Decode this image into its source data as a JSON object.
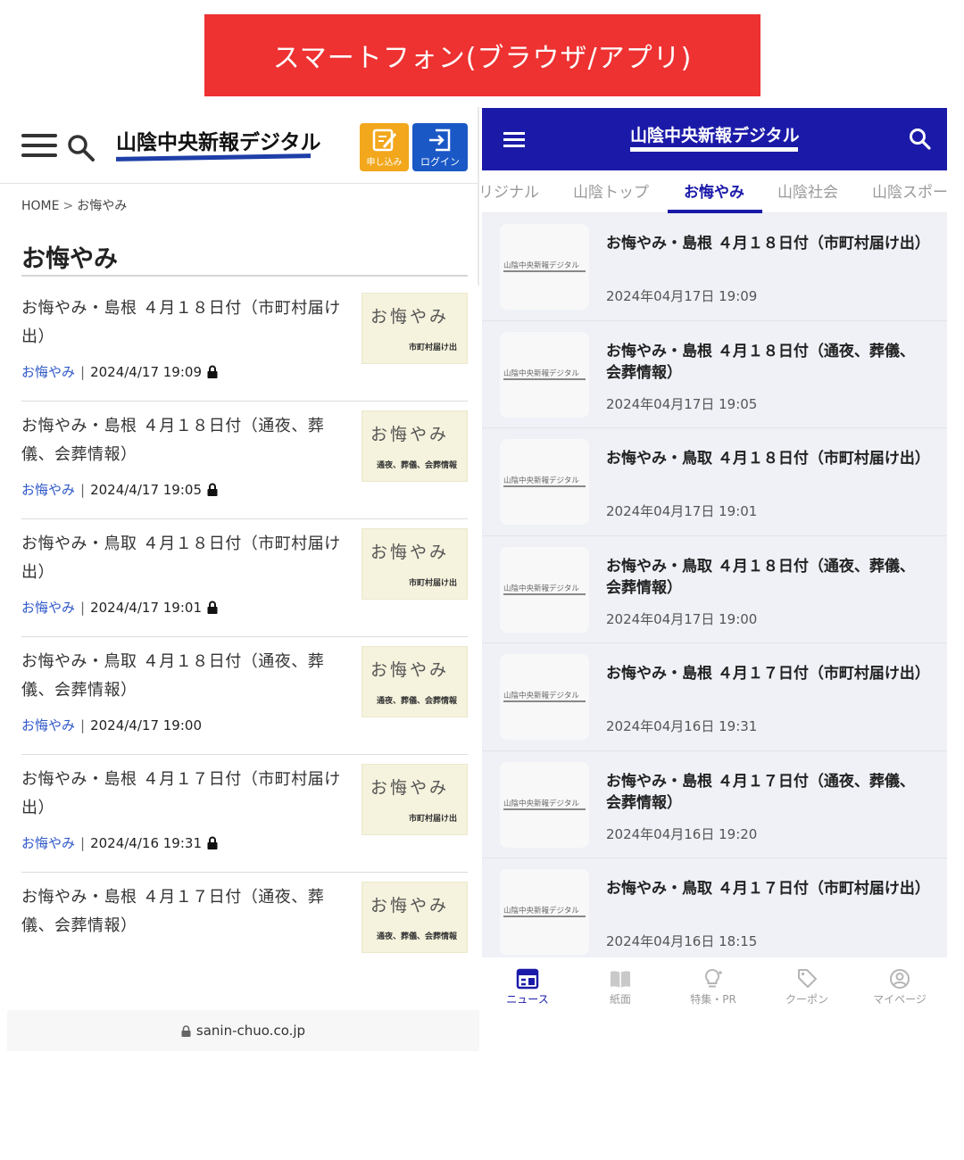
{
  "banner": {
    "text": "スマートフォン(ブラウザ/アプリ)"
  },
  "browser": {
    "logo": "山陰中央新報デジタル",
    "apply_label": "申し込み",
    "login_label": "ログイン",
    "breadcrumb": {
      "home": "HOME",
      "current": "お悔やみ"
    },
    "page_title": "お悔やみ",
    "articles": [
      {
        "title": "お悔やみ・島根 ４月１８日付（市町村届け出）",
        "category": "お悔やみ",
        "datetime": "2024/4/17 19:09",
        "locked": true,
        "thumb_main": "お悔やみ",
        "thumb_sub": "市町村届け出"
      },
      {
        "title": "お悔やみ・島根 ４月１８日付（通夜、葬儀、会葬情報）",
        "category": "お悔やみ",
        "datetime": "2024/4/17 19:05",
        "locked": true,
        "thumb_main": "お悔やみ",
        "thumb_sub": "通夜、葬儀、会葬情報"
      },
      {
        "title": "お悔やみ・鳥取 ４月１８日付（市町村届け出）",
        "category": "お悔やみ",
        "datetime": "2024/4/17 19:01",
        "locked": true,
        "thumb_main": "お悔やみ",
        "thumb_sub": "市町村届け出"
      },
      {
        "title": "お悔やみ・鳥取 ４月１８日付（通夜、葬儀、会葬情報）",
        "category": "お悔やみ",
        "datetime": "2024/4/17 19:00",
        "locked": false,
        "thumb_main": "お悔やみ",
        "thumb_sub": "通夜、葬儀、会葬情報"
      },
      {
        "title": "お悔やみ・島根 ４月１７日付（市町村届け出）",
        "category": "お悔やみ",
        "datetime": "2024/4/16 19:31",
        "locked": true,
        "thumb_main": "お悔やみ",
        "thumb_sub": "市町村届け出"
      },
      {
        "title": "お悔やみ・島根 ４月１７日付（通夜、葬儀、会葬情報）",
        "category": "",
        "datetime": "",
        "locked": false,
        "thumb_main": "お悔やみ",
        "thumb_sub": "通夜、葬儀、会葬情報"
      }
    ],
    "url": "sanin-chuo.co.jp"
  },
  "app": {
    "logo": "山陰中央新報デジタル",
    "tabs": [
      "リジナル",
      "山陰トップ",
      "お悔やみ",
      "山陰社会",
      "山陰スポー"
    ],
    "active_tab": "お悔やみ",
    "thumb_logo": "山陰中央新報デジタル",
    "articles": [
      {
        "title": "お悔やみ・島根 ４月１８日付（市町村届け出）",
        "datetime": "2024年04月17日 19:09"
      },
      {
        "title": "お悔やみ・島根 ４月１８日付（通夜、葬儀、会葬情報）",
        "datetime": "2024年04月17日 19:05"
      },
      {
        "title": "お悔やみ・鳥取 ４月１８日付（市町村届け出）",
        "datetime": "2024年04月17日 19:01"
      },
      {
        "title": "お悔やみ・鳥取 ４月１８日付（通夜、葬儀、会葬情報）",
        "datetime": "2024年04月17日 19:00"
      },
      {
        "title": "お悔やみ・島根 ４月１７日付（市町村届け出）",
        "datetime": "2024年04月16日 19:31"
      },
      {
        "title": "お悔やみ・島根 ４月１７日付（通夜、葬儀、会葬情報）",
        "datetime": "2024年04月16日 19:20"
      },
      {
        "title": "お悔やみ・鳥取 ４月１７日付（市町村届け出）",
        "datetime": "2024年04月16日 18:15"
      }
    ],
    "bottom_nav": [
      {
        "label": "ニュース",
        "icon": "news-icon",
        "active": true
      },
      {
        "label": "紙面",
        "icon": "book-icon",
        "active": false
      },
      {
        "label": "特集・PR",
        "icon": "lightbulb-icon",
        "active": false
      },
      {
        "label": "クーポン",
        "icon": "tag-icon",
        "active": false
      },
      {
        "label": "マイページ",
        "icon": "user-icon",
        "active": false
      }
    ]
  },
  "colors": {
    "banner": "#ee3131",
    "app_primary": "#1b1aa8",
    "link_blue": "#2f58c8",
    "apply_orange": "#f2a71c",
    "login_blue": "#1a58c6"
  }
}
